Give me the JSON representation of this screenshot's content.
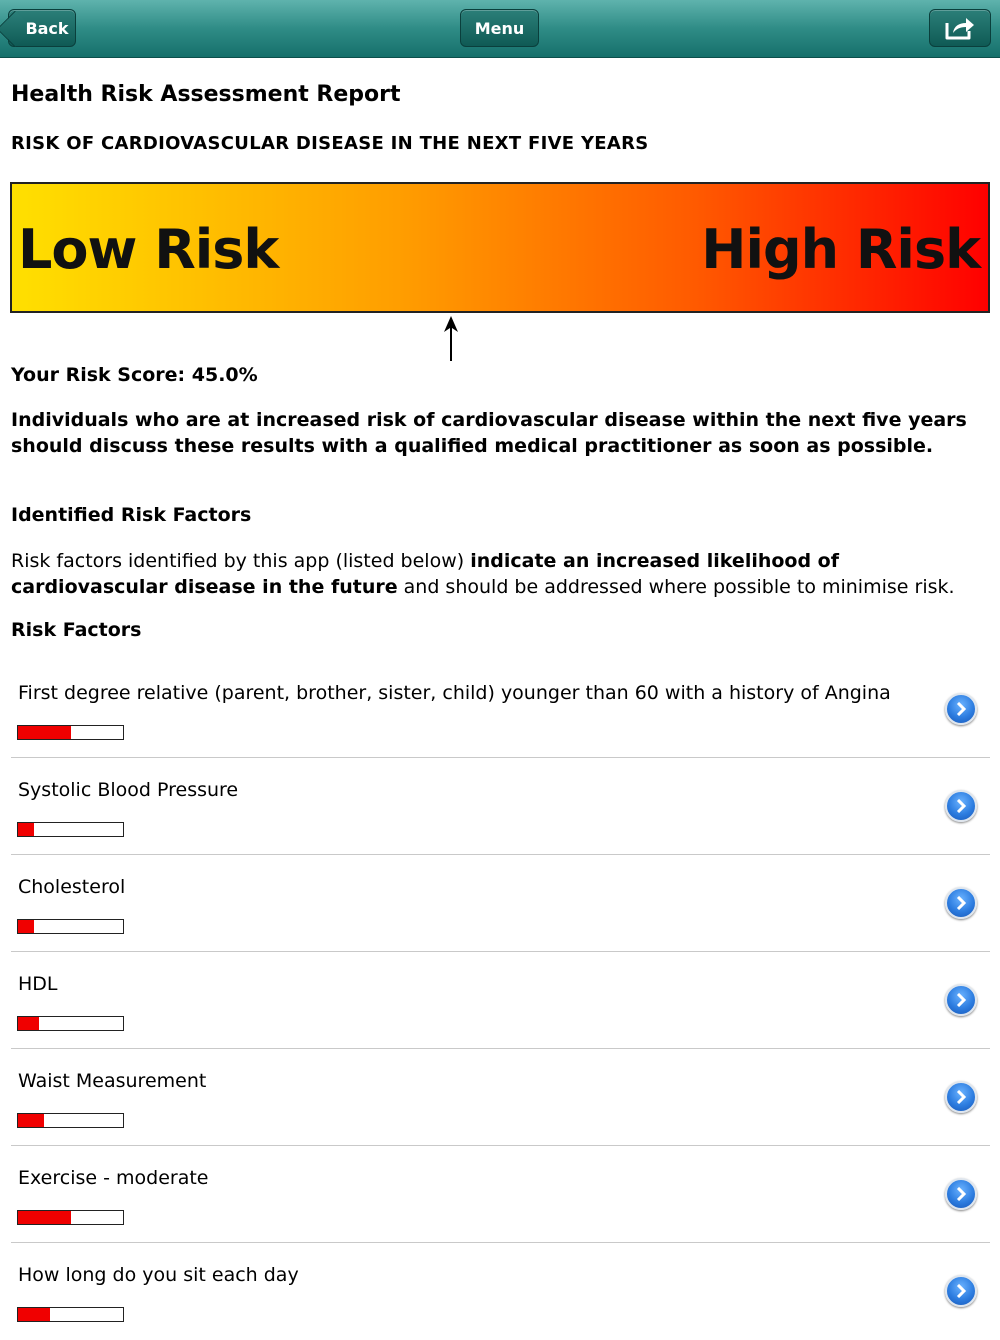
{
  "nav": {
    "back_label": "Back",
    "menu_label": "Menu",
    "share_icon": "share-icon"
  },
  "page": {
    "title": "Health Risk Assessment Report",
    "section_title": "RISK OF CARDIOVASCULAR DISEASE IN THE NEXT FIVE YEARS"
  },
  "risk_scale": {
    "low_label": "Low Risk",
    "high_label": "High Risk",
    "gradient_colors": [
      "#ffe000",
      "#ff9d00",
      "#ff5a00",
      "#ff0000"
    ],
    "score_percent": 45.0
  },
  "score": {
    "text": "Your Risk Score: 45.0%"
  },
  "warning": {
    "text": "Individuals who are at increased risk of cardiovascular disease within the next five years should discuss these results with a qualified medical practitioner as soon as possible."
  },
  "identified": {
    "heading": "Identified Risk Factors",
    "desc_before": "Risk factors identified by this app (listed below) ",
    "desc_bold": "indicate an increased likelihood of cardiovascular disease in the future",
    "desc_after": " and should be addressed where possible to minimise risk."
  },
  "factors": {
    "heading": "Risk Factors",
    "meter_color": "#f00000",
    "items": [
      {
        "label": "First degree relative (parent, brother, sister, child) younger than 60 with a history of Angina",
        "level": 0.5
      },
      {
        "label": "Systolic Blood Pressure",
        "level": 0.15
      },
      {
        "label": "Cholesterol",
        "level": 0.15
      },
      {
        "label": "HDL",
        "level": 0.2
      },
      {
        "label": "Waist Measurement",
        "level": 0.25
      },
      {
        "label": "Exercise - moderate",
        "level": 0.5
      },
      {
        "label": "How long do you sit each day",
        "level": 0.3
      }
    ]
  }
}
